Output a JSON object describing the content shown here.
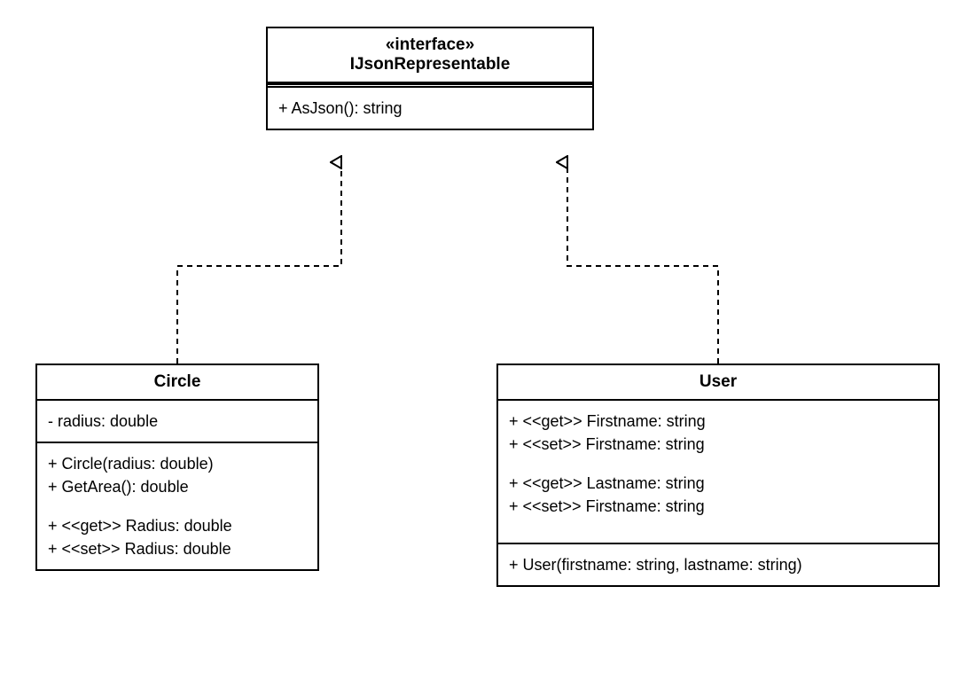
{
  "interface": {
    "stereotype": "«interface»",
    "name": "IJsonRepresentable",
    "methods": [
      "+ AsJson(): string"
    ]
  },
  "circle": {
    "name": "Circle",
    "attributes": [
      "- radius: double"
    ],
    "methods": [
      "+ Circle(radius: double)",
      "+ GetArea(): double",
      "",
      "+ <<get>> Radius: double",
      "+ <<set>> Radius: double"
    ]
  },
  "user": {
    "name": "User",
    "attributes": [
      "+ <<get>> Firstname: string",
      "+ <<set>> Firstname: string",
      "",
      "+ <<get>> Lastname: string",
      "+ <<set>> Firstname: string"
    ],
    "methods": [
      "+ User(firstname: string, lastname: string)"
    ]
  }
}
